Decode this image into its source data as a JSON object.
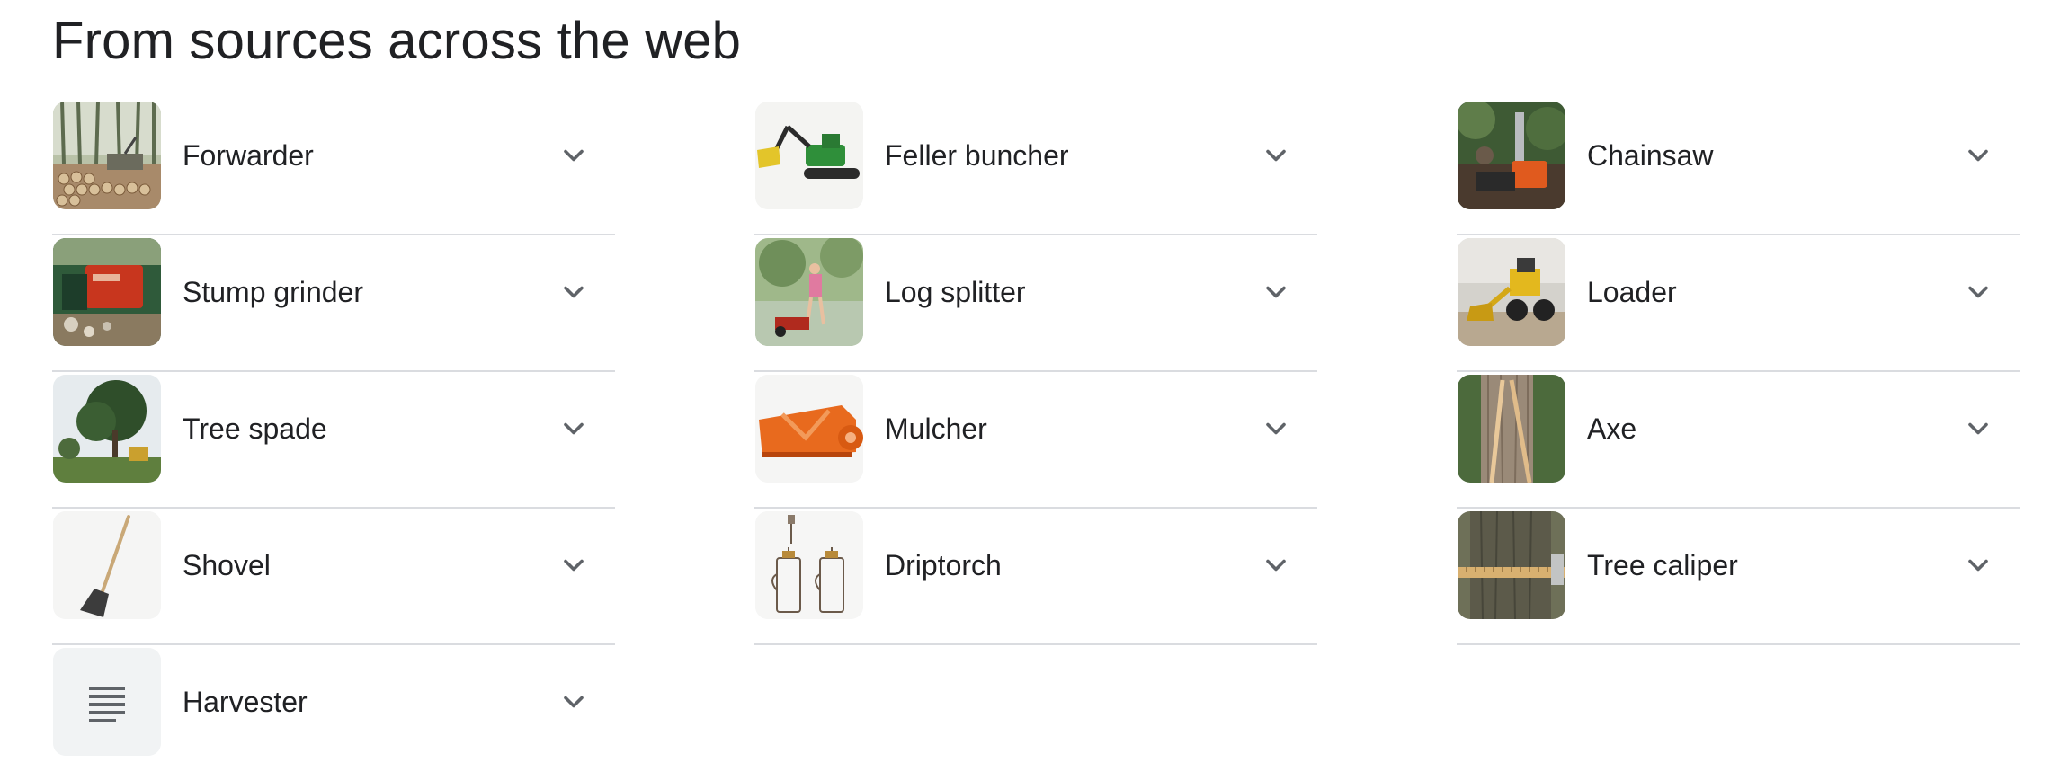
{
  "heading": "From sources across the web",
  "columns": [
    {
      "items": [
        {
          "label": "Forwarder",
          "icon": "forwarder-thumbnail"
        },
        {
          "label": "Stump grinder",
          "icon": "stump-grinder-thumbnail"
        },
        {
          "label": "Tree spade",
          "icon": "tree-spade-thumbnail"
        },
        {
          "label": "Shovel",
          "icon": "shovel-thumbnail"
        },
        {
          "label": "Harvester",
          "icon": "document-lines-icon"
        }
      ]
    },
    {
      "items": [
        {
          "label": "Feller buncher",
          "icon": "feller-buncher-thumbnail"
        },
        {
          "label": "Log splitter",
          "icon": "log-splitter-thumbnail"
        },
        {
          "label": "Mulcher",
          "icon": "mulcher-thumbnail"
        },
        {
          "label": "Driptorch",
          "icon": "driptorch-thumbnail"
        }
      ]
    },
    {
      "items": [
        {
          "label": "Chainsaw",
          "icon": "chainsaw-thumbnail"
        },
        {
          "label": "Loader",
          "icon": "loader-thumbnail"
        },
        {
          "label": "Axe",
          "icon": "axe-thumbnail"
        },
        {
          "label": "Tree caliper",
          "icon": "tree-caliper-thumbnail"
        }
      ]
    }
  ],
  "expand_icon": "chevron-down-icon"
}
